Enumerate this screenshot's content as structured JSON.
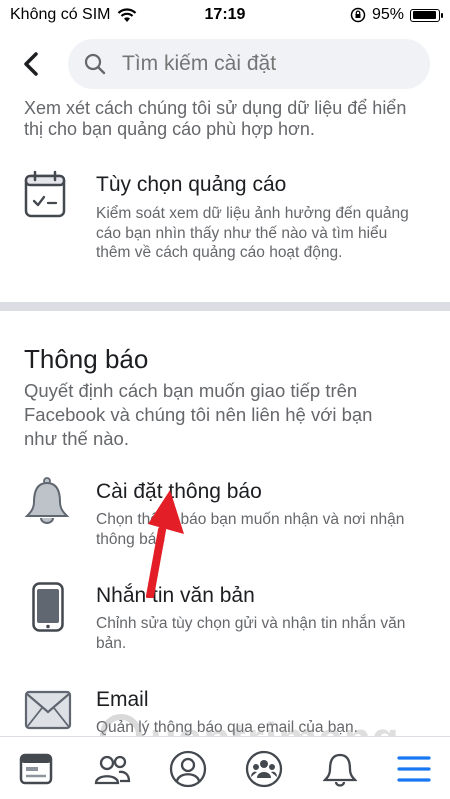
{
  "status_bar": {
    "carrier": "Không có SIM",
    "time": "17:19",
    "battery_text": "95%",
    "battery_level": 0.95
  },
  "search": {
    "placeholder": "Tìm kiếm cài đặt"
  },
  "ads_section": {
    "intro": "Xem xét cách chúng tôi sử dụng dữ liệu để hiển thị cho bạn quảng cáo phù hợp hơn.",
    "items": [
      {
        "icon": "calendar-check-icon",
        "title": "Tùy chọn quảng cáo",
        "subtitle": "Kiểm soát xem dữ liệu ảnh hưởng đến quảng cáo bạn nhìn thấy như thế nào và tìm hiểu thêm về cách quảng cáo hoạt động."
      }
    ]
  },
  "notifications_section": {
    "title": "Thông báo",
    "description": "Quyết định cách bạn muốn giao tiếp trên Facebook và chúng tôi nên liên hệ với bạn như thế nào.",
    "items": [
      {
        "icon": "bell-icon",
        "title": "Cài đặt thông báo",
        "subtitle": "Chọn thông báo bạn muốn nhận và nơi nhận thông báo"
      },
      {
        "icon": "phone-icon",
        "title": "Nhắn tin văn bản",
        "subtitle": "Chỉnh sửa tùy chọn gửi và nhận tin nhắn văn bản."
      },
      {
        "icon": "envelope-icon",
        "title": "Email",
        "subtitle": "Quản lý thông báo qua email của bạn."
      }
    ]
  },
  "watermark": "uantrimang",
  "tab_bar": {
    "tabs": [
      "news-feed-icon",
      "friends-icon",
      "profile-icon",
      "groups-icon",
      "notifications-bell-icon",
      "menu-icon"
    ],
    "active_color": "#1877f2",
    "inactive_color": "#65676b"
  },
  "colors": {
    "search_bg": "#f0f2f5",
    "divider": "#dadde1",
    "arrow": "#e41e26"
  }
}
